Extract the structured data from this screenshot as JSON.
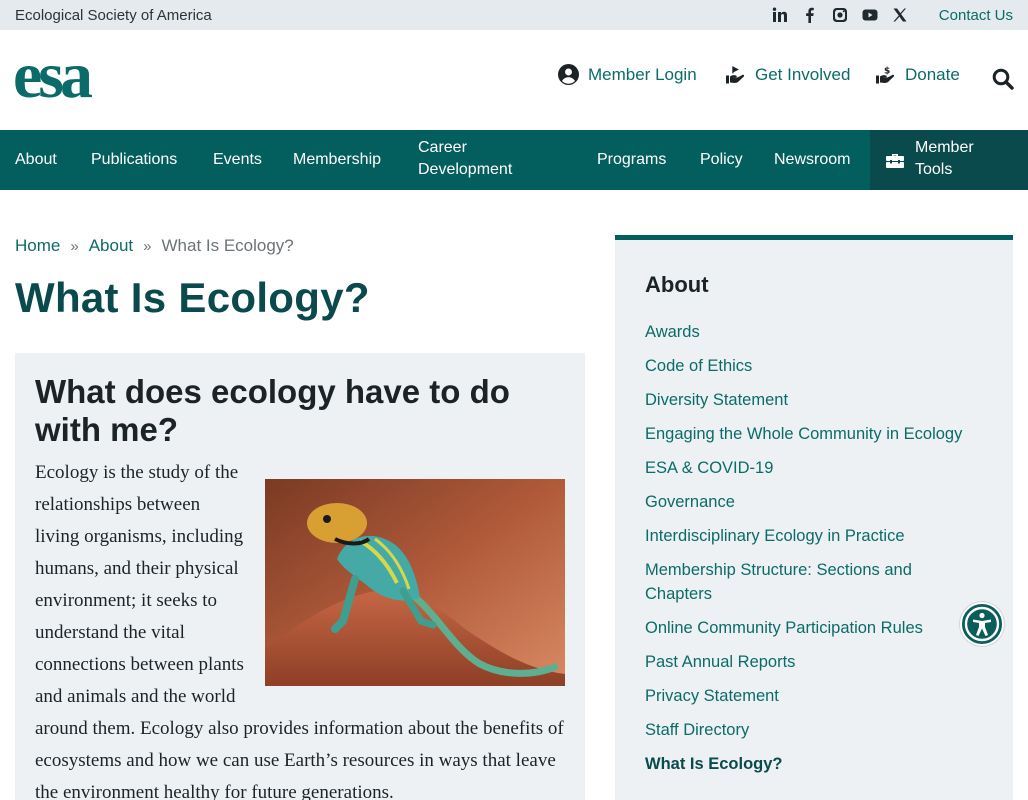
{
  "topbar": {
    "org_name": "Ecological Society of America",
    "social_icons": [
      "linkedin-icon",
      "facebook-icon",
      "instagram-icon",
      "youtube-icon",
      "x-icon"
    ],
    "contact_label": "Contact Us"
  },
  "header": {
    "logo_text": "esa",
    "links": [
      {
        "icon": "user-circle-icon",
        "label": "Member Login"
      },
      {
        "icon": "hand-icon",
        "label": "Get Involved"
      },
      {
        "icon": "donate-hand-icon",
        "label": "Donate"
      }
    ],
    "search_icon": "search-icon"
  },
  "nav": {
    "items": [
      "About",
      "Publications",
      "Events",
      "Membership",
      "Career Development",
      "Programs",
      "Policy",
      "Newsroom"
    ],
    "career_line1": "Career",
    "career_line2": "Development",
    "tools_line1": "Member",
    "tools_line2": "Tools"
  },
  "breadcrumb": {
    "home": "Home",
    "parent": "About",
    "current": "What Is Ecology?",
    "separator": "»"
  },
  "page_title": "What Is Ecology?",
  "card": {
    "heading": "What does ecology have to do with me?",
    "para_narrow": "Ecology is the study of the relationships between living organisms, including humans, and their physical environment; it seeks to understand the vital connections between plants and animals and the world",
    "para_wide": "around them. Ecology also provides information about the benefits of ecosystems and how we can use Earth’s resources in ways that leave the environment healthy for future generations."
  },
  "sidebar": {
    "title": "About",
    "items": [
      "Awards",
      "Code of Ethics",
      "Diversity Statement",
      "Engaging the Whole Community in Ecology",
      "ESA & COVID-19",
      "Governance",
      "Interdisciplinary Ecology in Practice",
      "Membership Structure: Sections and Chapters",
      "Online Community Participation Rules",
      "Past Annual Reports",
      "Privacy Statement",
      "Staff Directory",
      "What Is Ecology?"
    ],
    "active_index": 12
  },
  "colors": {
    "brand_teal": "#035f5e",
    "dark_teal": "#0b4a4c",
    "link_teal": "#0b6b68",
    "topbar_bg": "#e4eaed",
    "panel_bg": "#edf1f4"
  }
}
